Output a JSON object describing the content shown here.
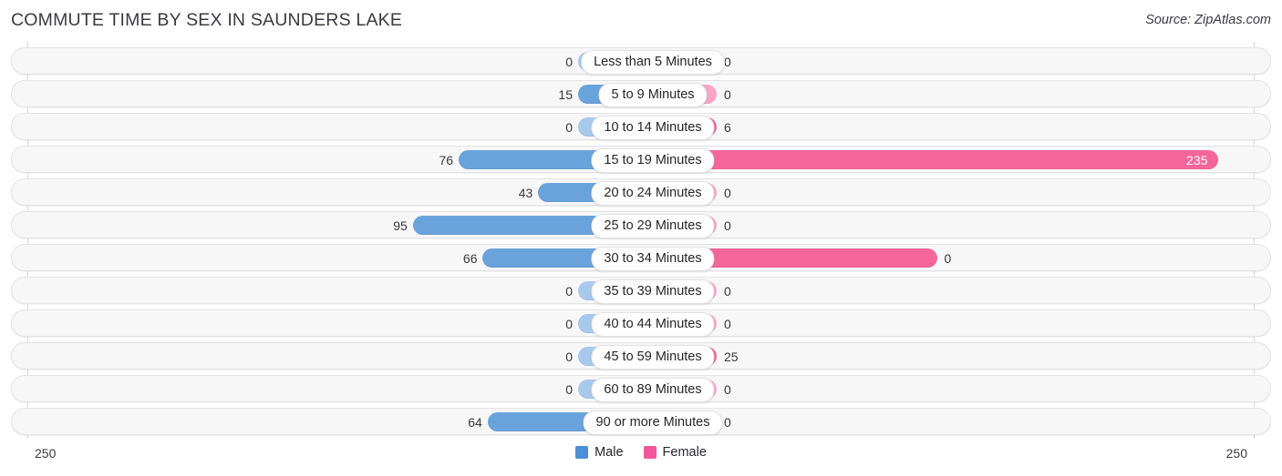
{
  "header": {
    "title": "COMMUTE TIME BY SEX IN SAUNDERS LAKE",
    "source": "Source: ZipAtlas.com"
  },
  "legend": {
    "male": {
      "label": "Male",
      "color": "#4a90d9"
    },
    "female": {
      "label": "Female",
      "color": "#f2569a"
    }
  },
  "axis": {
    "left_tick": "250",
    "right_tick": "250",
    "max": 250
  },
  "colors": {
    "male_strong": "#6aa3dc",
    "male_light": "#a9c9ec",
    "female_strong": "#f4669a",
    "female_light": "#f8a6c4",
    "row_background": "#f7f7f7",
    "row_border": "#e3e3e6",
    "title_text": "#3a3a44"
  },
  "chart_data": {
    "type": "bar",
    "orientation": "horizontal-diverging",
    "title": "COMMUTE TIME BY SEX IN SAUNDERS LAKE",
    "xlabel": "",
    "ylabel": "",
    "xlim": [
      250,
      250
    ],
    "grid": false,
    "legend_position": "bottom-center",
    "categories": [
      "Less than 5 Minutes",
      "5 to 9 Minutes",
      "10 to 14 Minutes",
      "15 to 19 Minutes",
      "20 to 24 Minutes",
      "25 to 29 Minutes",
      "30 to 34 Minutes",
      "35 to 39 Minutes",
      "40 to 44 Minutes",
      "45 to 59 Minutes",
      "60 to 89 Minutes",
      "90 or more Minutes"
    ],
    "series": [
      {
        "name": "Male",
        "direction": "left",
        "values": [
          0,
          15,
          0,
          76,
          43,
          95,
          66,
          0,
          0,
          0,
          0,
          64
        ]
      },
      {
        "name": "Female",
        "direction": "right",
        "values": [
          0,
          0,
          6,
          235,
          0,
          0,
          118,
          0,
          0,
          25,
          0,
          0
        ]
      }
    ]
  },
  "rows": [
    {
      "label": "Less than 5 Minutes",
      "male": "0",
      "female": "0"
    },
    {
      "label": "5 to 9 Minutes",
      "male": "15",
      "female": "0"
    },
    {
      "label": "10 to 14 Minutes",
      "male": "0",
      "female": "6"
    },
    {
      "label": "15 to 19 Minutes",
      "male": "76",
      "female": "235"
    },
    {
      "label": "20 to 24 Minutes",
      "male": "43",
      "female": "0"
    },
    {
      "label": "25 to 29 Minutes",
      "male": "95",
      "female": "0"
    },
    {
      "label": "30 to 34 Minutes",
      "male": "66",
      "female": "0"
    },
    {
      "label": "35 to 39 Minutes",
      "male": "0",
      "female": "0"
    },
    {
      "label": "40 to 44 Minutes",
      "male": "0",
      "female": "0"
    },
    {
      "label": "45 to 59 Minutes",
      "male": "0",
      "female": "25"
    },
    {
      "label": "60 to 89 Minutes",
      "male": "0",
      "female": "0"
    },
    {
      "label": "90 or more Minutes",
      "male": "64",
      "female": "0"
    }
  ]
}
